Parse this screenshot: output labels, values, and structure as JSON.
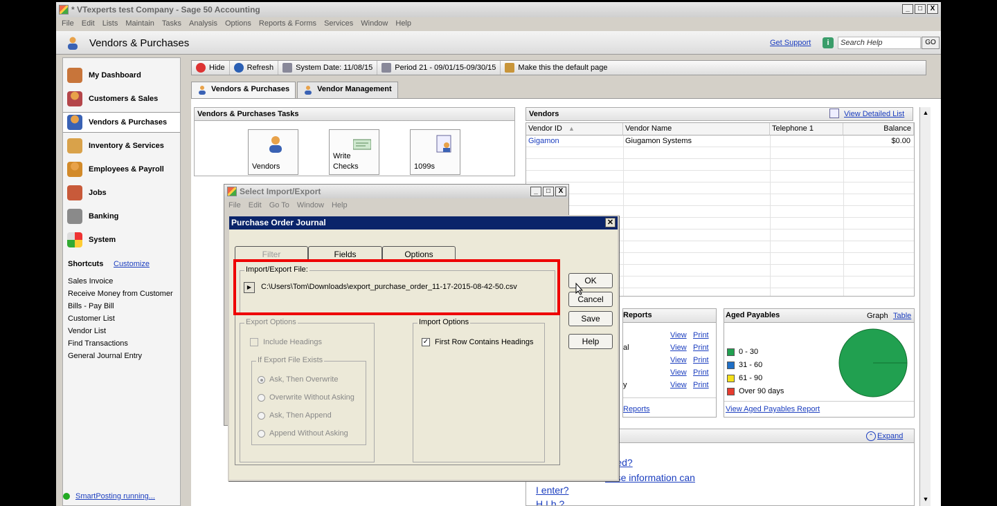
{
  "window": {
    "title": "* VTexperts test Company - Sage 50 Accounting",
    "buttons": [
      "_",
      "□",
      "X"
    ]
  },
  "menu": [
    "File",
    "Edit",
    "Lists",
    "Maintain",
    "Tasks",
    "Analysis",
    "Options",
    "Reports & Forms",
    "Services",
    "Window",
    "Help"
  ],
  "header": {
    "title": "Vendors & Purchases",
    "support": "Get Support",
    "search_placeholder": "Search Help",
    "go": "GO"
  },
  "nav": {
    "items": [
      {
        "label": "My Dashboard"
      },
      {
        "label": "Customers & Sales"
      },
      {
        "label": "Vendors & Purchases"
      },
      {
        "label": "Inventory & Services"
      },
      {
        "label": "Employees & Payroll"
      },
      {
        "label": "Jobs"
      },
      {
        "label": "Banking"
      },
      {
        "label": "System"
      }
    ],
    "shortcuts_title": "Shortcuts",
    "customize": "Customize",
    "shortcuts": [
      "Sales Invoice",
      "Receive Money from Customer",
      "Bills - Pay Bill",
      "Customer List",
      "Vendor List",
      "Find Transactions",
      "General Journal Entry"
    ],
    "smartposting": "SmartPosting running..."
  },
  "toolbar": {
    "hide": "Hide",
    "refresh": "Refresh",
    "system_date": "System Date: 11/08/15",
    "period": "Period 21 - 09/01/15-09/30/15",
    "default_page": "Make this the default page"
  },
  "tabs": {
    "vendors_purchases": "Vendors & Purchases",
    "vendor_management": "Vendor Management"
  },
  "tasks": {
    "title": "Vendors & Purchases Tasks",
    "tiles": [
      "Vendors",
      "Write",
      "Checks",
      "1099s"
    ]
  },
  "vendors": {
    "title": "Vendors",
    "view_detailed": "View Detailed List",
    "columns": [
      "Vendor ID",
      "Vendor Name",
      "Telephone 1",
      "Balance"
    ],
    "rows": [
      {
        "id": "Gigamon",
        "name": "Giugamon Systems",
        "phone": "",
        "balance": "$0.00"
      }
    ]
  },
  "reports": {
    "title": "Reports",
    "partial": [
      "al",
      "y"
    ],
    "view": "View",
    "print": "Print",
    "footer": "Reports"
  },
  "aged": {
    "title": "Aged Payables",
    "graph": "Graph",
    "table": "Table",
    "legend": [
      {
        "label": "0 - 30",
        "color": "#21a050"
      },
      {
        "label": "31 - 60",
        "color": "#1f6fc6"
      },
      {
        "label": "61 - 90",
        "color": "#f4e01a"
      },
      {
        "label": "Over 90 days",
        "color": "#e63b2e"
      }
    ],
    "report_link": "View Aged Payables Report"
  },
  "help_panel": {
    "expand": "Expand",
    "lines": [
      "arted?",
      "hase information can",
      "I enter?",
      "H           I               b          ?"
    ]
  },
  "select_dialog": {
    "title": "Select Import/Export",
    "menu": [
      "File",
      "Edit",
      "Go To",
      "Window",
      "Help"
    ]
  },
  "dialog": {
    "title": "Purchase Order Journal",
    "tabs": [
      "Filter",
      "Fields",
      "Options"
    ],
    "file_label": "Import/Export File:",
    "file_path": "C:\\Users\\Tom\\Downloads\\export_purchase_order_11-17-2015-08-42-50.csv",
    "export_options": "Export Options",
    "include_headings": "Include Headings",
    "if_exists": "If Export File Exists",
    "radios": [
      "Ask, Then Overwrite",
      "Overwrite Without Asking",
      "Ask, Then Append",
      "Append Without Asking"
    ],
    "import_options": "Import Options",
    "first_row": "First Row Contains Headings",
    "buttons": [
      "OK",
      "Cancel",
      "Save",
      "Help"
    ]
  }
}
